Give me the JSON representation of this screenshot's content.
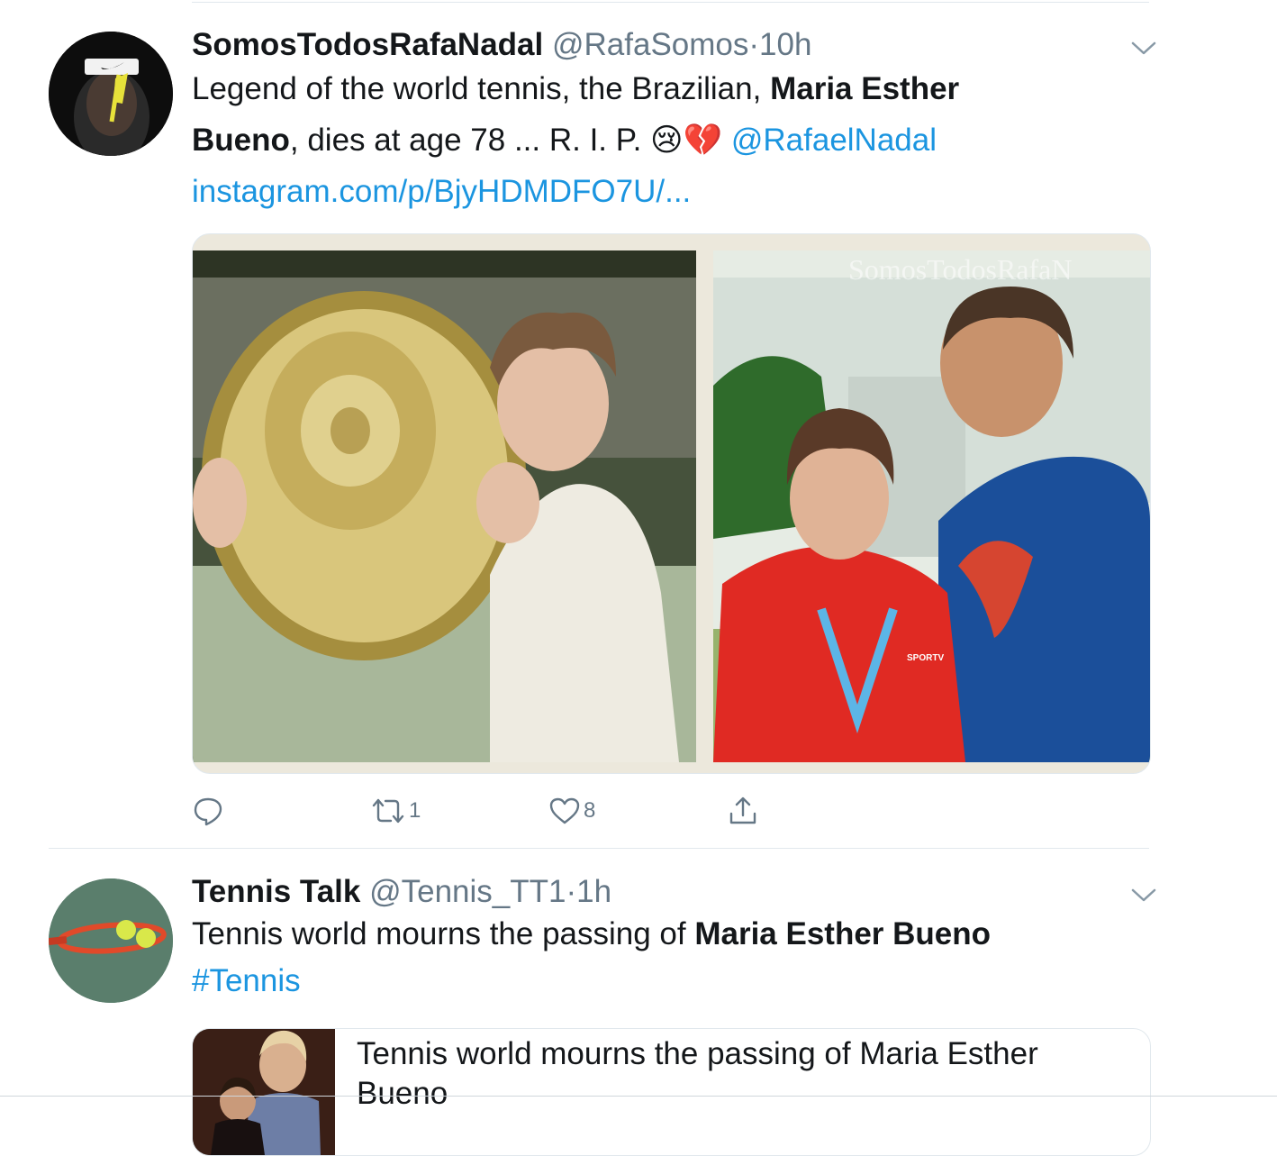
{
  "tweets": [
    {
      "name": "SomosTodosRafaNadal",
      "handle": "@RafaSomos",
      "separator": "·",
      "time": "10h",
      "text": {
        "t1": "Legend of the world tennis, the Brazilian, ",
        "b1": "Maria Esther",
        "b2": "Bueno",
        "t2": ", dies at age 78 ... R. I. P. ",
        "emoji": "😢💔",
        "mention": "@RafaelNadal",
        "url": "instagram.com/p/BjyHDMDFO7U/..."
      },
      "media": {
        "watermark": "SomosTodosRafaN",
        "badge": "SPORTV"
      },
      "actions": {
        "reply_count": "",
        "retweet_count": "1",
        "like_count": "8"
      }
    },
    {
      "name": "Tennis Talk",
      "handle": "@Tennis_TT1",
      "separator": "·",
      "time": "1h",
      "text": {
        "t1": "Tennis world mourns the passing of ",
        "b1": "Maria Esther Bueno",
        "hashtag": "#Tennis"
      },
      "card": {
        "title": "Tennis world mourns the passing of Maria Esther Bueno"
      }
    }
  ],
  "colors": {
    "link": "#1b95e0",
    "meta": "#657786",
    "divider": "#e1e8ed"
  },
  "icons": [
    "nike-avatar-icon",
    "chevron-down-icon",
    "reply-icon",
    "retweet-icon",
    "like-icon",
    "share-icon",
    "tennis-racket-avatar-icon"
  ]
}
